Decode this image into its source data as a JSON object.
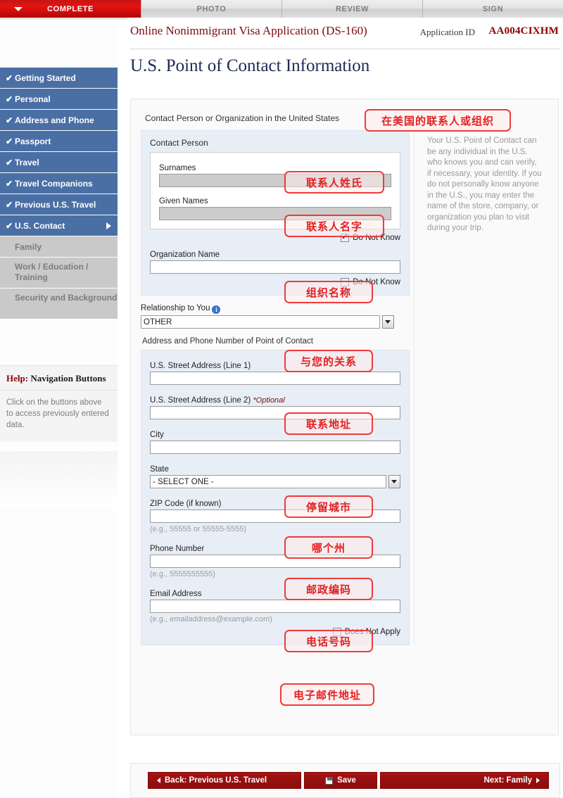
{
  "tabs": [
    {
      "label": "COMPLETE",
      "state": "active"
    },
    {
      "label": "PHOTO",
      "state": "inactive"
    },
    {
      "label": "REVIEW",
      "state": "inactive"
    },
    {
      "label": "SIGN",
      "state": "inactive"
    }
  ],
  "header": {
    "title": "Online Nonimmigrant Visa Application (DS-160)",
    "app_id_label": "Application ID",
    "app_id_value": "AA004CIXHM"
  },
  "page_title": "U.S. Point of Contact Information",
  "sidebar": {
    "items": [
      {
        "label": "Getting Started",
        "state": "done"
      },
      {
        "label": "Personal",
        "state": "done"
      },
      {
        "label": "Address and Phone",
        "state": "done"
      },
      {
        "label": "Passport",
        "state": "done"
      },
      {
        "label": "Travel",
        "state": "done"
      },
      {
        "label": "Travel Companions",
        "state": "done"
      },
      {
        "label": "Previous U.S. Travel",
        "state": "done"
      },
      {
        "label": "U.S. Contact",
        "state": "active"
      },
      {
        "label": "Family",
        "state": "pending"
      },
      {
        "label": "Work / Education / Training",
        "state": "pending"
      },
      {
        "label": "Security and Background",
        "state": "pending"
      }
    ],
    "help": {
      "title_word": "Help:",
      "title_rest": " Navigation Buttons",
      "body": "Click on the buttons above to access previously entered data."
    }
  },
  "form": {
    "section_heading": "Contact Person or Organization in the United States",
    "contact_person": {
      "legend": "Contact Person",
      "surnames_label": "Surnames",
      "surnames_value": "",
      "given_names_label": "Given Names",
      "given_names_value": "",
      "do_not_know_label": "Do Not Know",
      "do_not_know_checked": true
    },
    "organization": {
      "label": "Organization Name",
      "value": "",
      "do_not_know_label": "Do Not Know",
      "do_not_know_checked": false
    },
    "relationship": {
      "label": "Relationship to You",
      "value": "OTHER"
    },
    "address_heading": "Address and Phone Number of Point of Contact",
    "street1": {
      "label": "U.S. Street Address (Line 1)",
      "value": ""
    },
    "street2": {
      "label": "U.S. Street Address (Line 2)",
      "optional": "*Optional",
      "value": ""
    },
    "city": {
      "label": "City",
      "value": ""
    },
    "state": {
      "label": "State",
      "value": "- SELECT ONE -"
    },
    "zip": {
      "label": "ZIP Code (if known)",
      "value": "",
      "hint": "(e.g., 55555 or 55555-5555)"
    },
    "phone": {
      "label": "Phone Number",
      "value": "",
      "hint": "(e.g., 5555555555)"
    },
    "email": {
      "label": "Email Address",
      "value": "",
      "hint": "(e.g., emailaddress@example.com)",
      "does_not_apply_label": "Does Not Apply",
      "does_not_apply_checked": false
    }
  },
  "help_panel": {
    "text": "Your U.S. Point of Contact can be any individual in the U.S. who knows you and can verify, if necessary, your identity. If you do not personally know anyone in the U.S., you may enter the name of the store, company, or organization you plan to visit during your trip."
  },
  "annotations": {
    "section": "在美国的联系人或组织",
    "surnames": "联系人姓氏",
    "given_names": "联系人名字",
    "organization": "组织名称",
    "relationship": "与您的关系",
    "street1": "联系地址",
    "city": "停留城市",
    "state": "哪个州",
    "zip": "邮政编码",
    "phone": "电话号码",
    "email": "电子邮件地址"
  },
  "footer": {
    "back_label": "Back: Previous U.S. Travel",
    "save_label": "Save",
    "next_label": "Next: Family"
  },
  "colors": {
    "brand_red": "#c81414",
    "nav_blue": "#4a6fa5",
    "nav_grey": "#c9c9c9",
    "title_navy": "#1d2a55",
    "annotation_red": "#e32020",
    "button_red": "#a81212"
  }
}
